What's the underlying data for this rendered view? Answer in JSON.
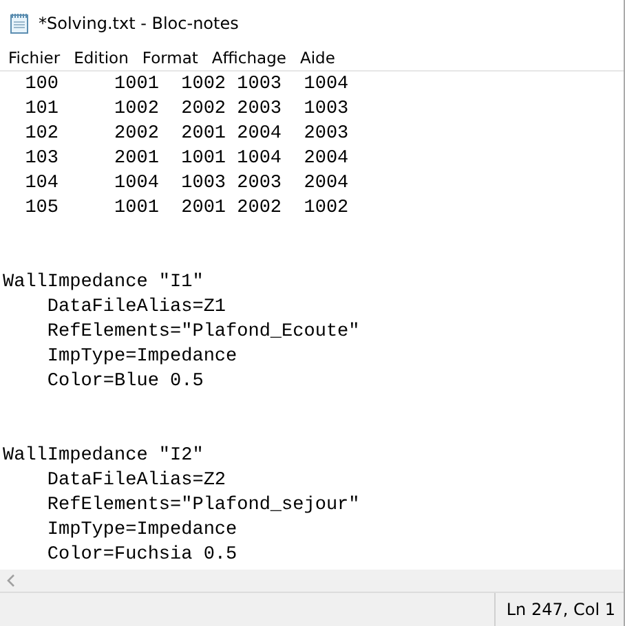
{
  "window": {
    "title": "*Solving.txt - Bloc-notes"
  },
  "menu": [
    "Fichier",
    "Edition",
    "Format",
    "Affichage",
    "Aide"
  ],
  "editor": {
    "blocks": [
      {
        "lines": [
          "  100     1001  1002 1003  1004",
          "  101     1002  2002 2003  1003",
          "  102     2002  2001 2004  2003",
          "  103     2001  1001 1004  2004",
          "  104     1004  1003 2003  2004",
          "  105     1001  2001 2002  1002"
        ]
      },
      {
        "lines": [
          "WallImpedance \"I1\"",
          "    DataFileAlias=Z1",
          "    RefElements=\"Plafond_Ecoute\"",
          "    ImpType=Impedance",
          "    Color=Blue 0.5"
        ]
      },
      {
        "lines": [
          "WallImpedance \"I2\"",
          "    DataFileAlias=Z2",
          "    RefElements=\"Plafond_sejour\"",
          "    ImpType=Impedance",
          "    Color=Fuchsia 0.5"
        ]
      }
    ]
  },
  "status_bar": {
    "position": "Ln 247, Col 1"
  }
}
